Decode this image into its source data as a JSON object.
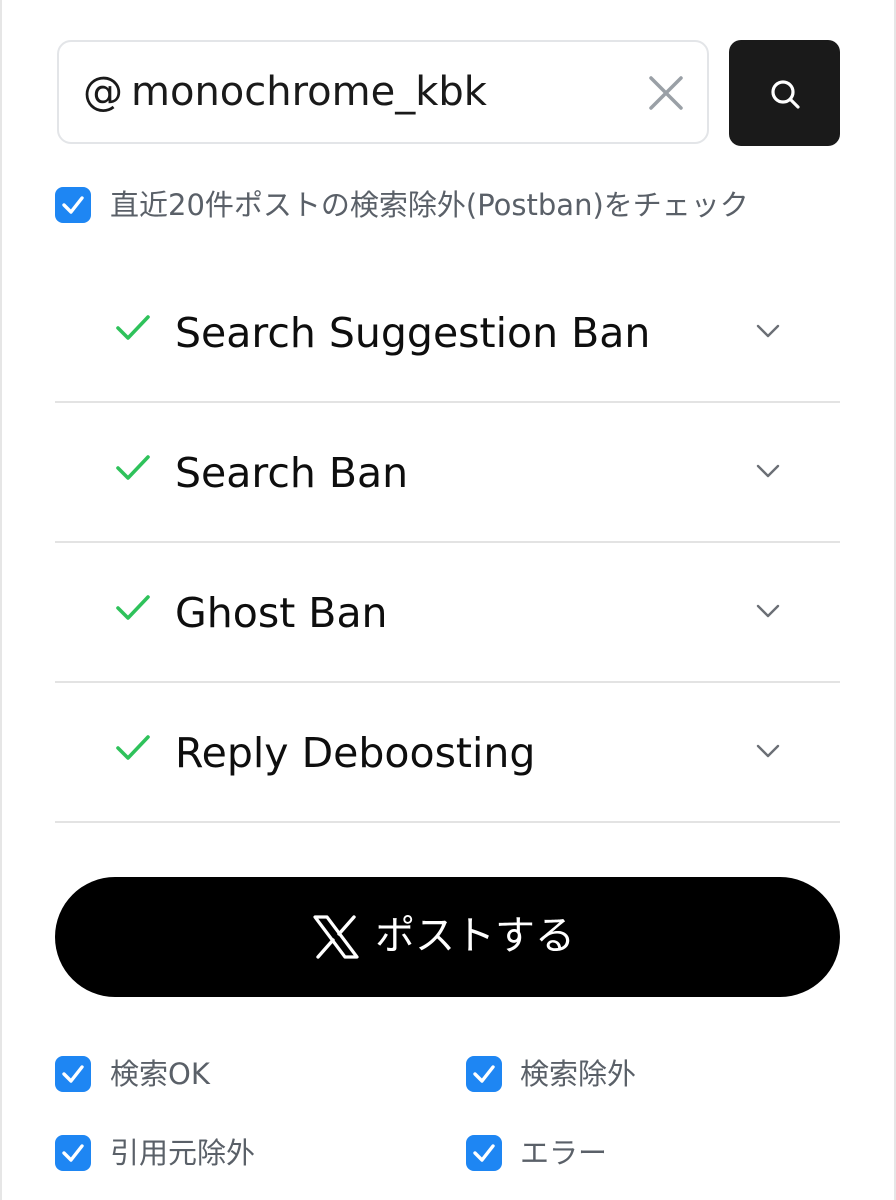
{
  "search": {
    "prefix": "@",
    "value": "monochrome_kbk"
  },
  "postban_option": {
    "checked": true,
    "label": "直近20件ポストの検索除外(Postban)をチェック"
  },
  "results": [
    {
      "title": "Search Suggestion Ban",
      "status": "ok"
    },
    {
      "title": "Search Ban",
      "status": "ok"
    },
    {
      "title": "Ghost Ban",
      "status": "ok"
    },
    {
      "title": "Reply Deboosting",
      "status": "ok"
    }
  ],
  "post_button": {
    "label": "ポストする",
    "icon": "x-logo-icon"
  },
  "legend": [
    {
      "label": "検索OK",
      "checked": true
    },
    {
      "label": "検索除外",
      "checked": true
    },
    {
      "label": "引用元除外",
      "checked": true
    },
    {
      "label": "エラー",
      "checked": true
    }
  ],
  "colors": {
    "accent_blue": "#1e86f3",
    "ok_green": "#2fc25b",
    "button_black": "#000000"
  }
}
